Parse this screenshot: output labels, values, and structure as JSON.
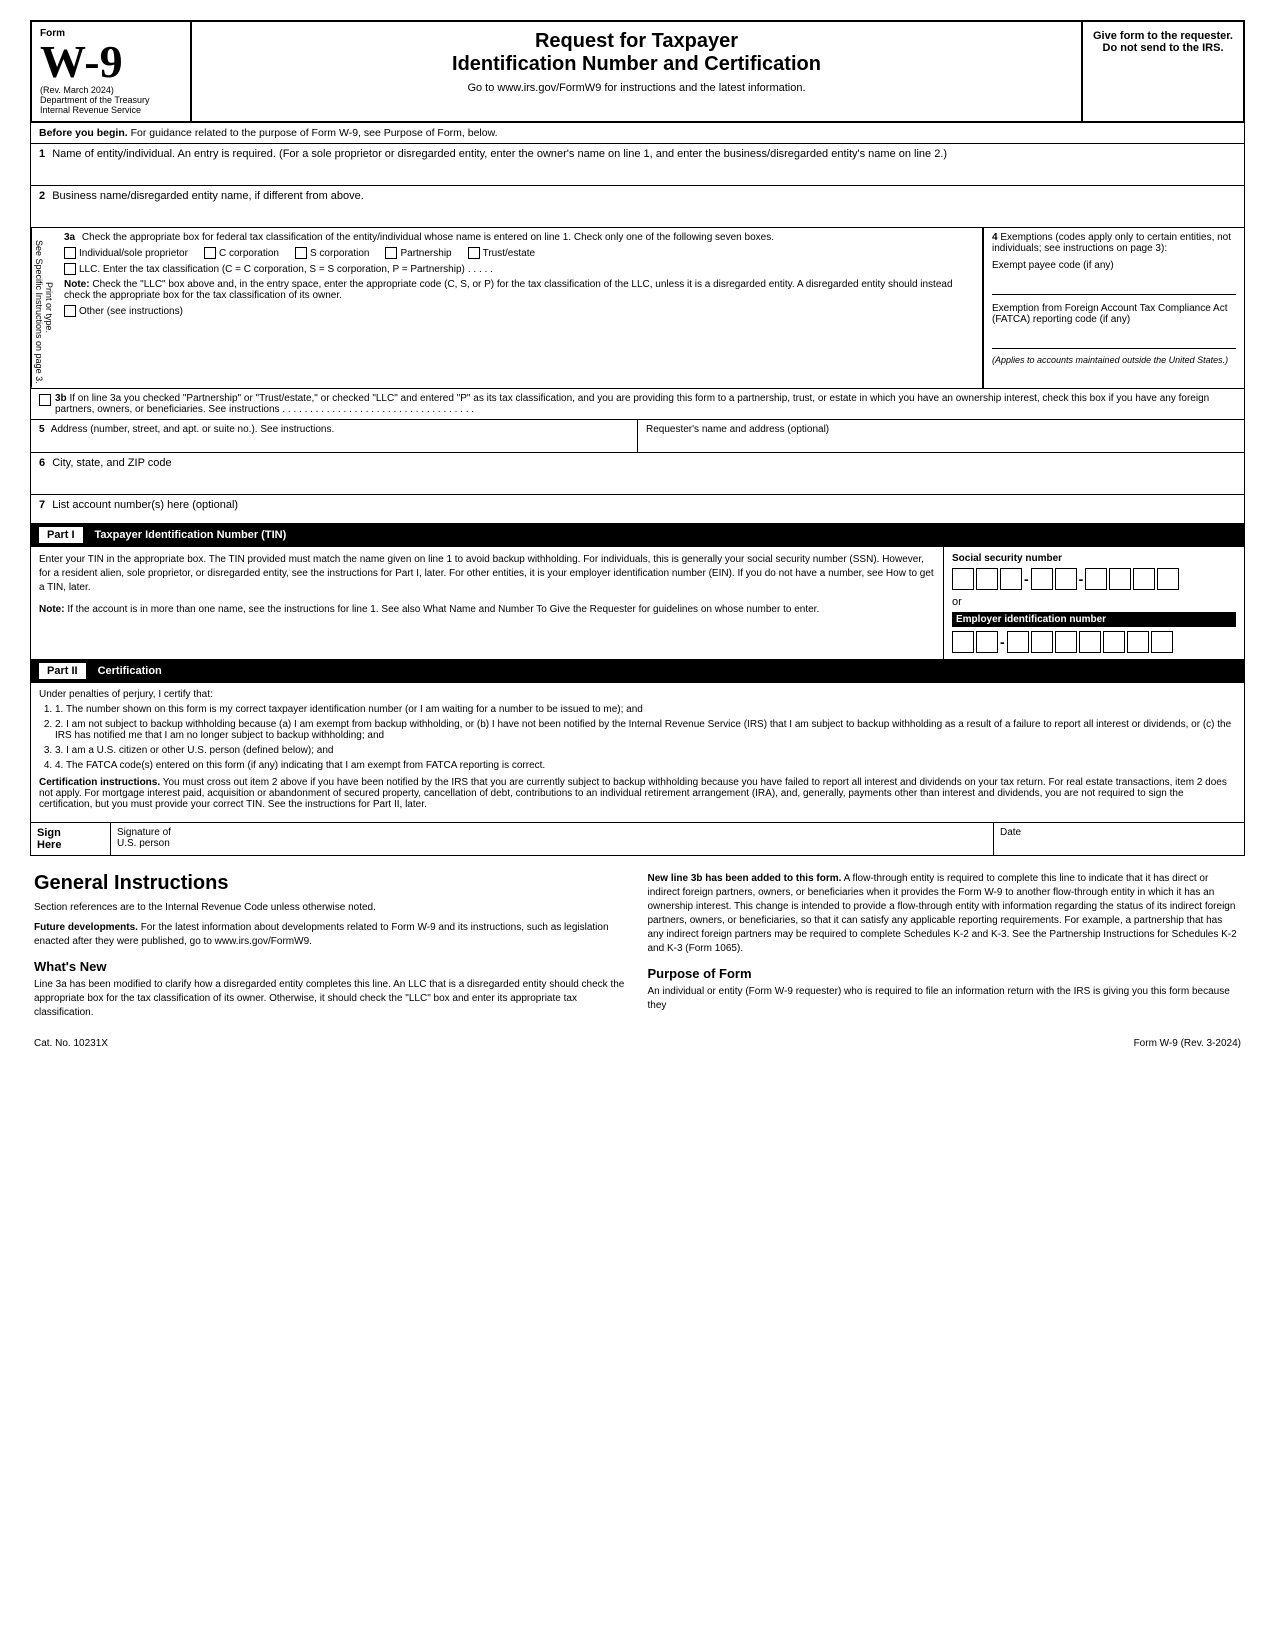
{
  "header": {
    "form_label": "Form",
    "form_number": "W-9",
    "rev_date": "(Rev. March 2024)",
    "dept": "Department of the Treasury",
    "irs": "Internal Revenue Service",
    "title1": "Request for Taxpayer",
    "title2": "Identification Number and Certification",
    "url_instruction": "Go to www.irs.gov/FormW9 for instructions and the latest information.",
    "give_form": "Give form to the requester. Do not send to the IRS."
  },
  "before_begin": {
    "label": "Before you begin.",
    "text": "For guidance related to the purpose of Form W-9, see Purpose of Form, below."
  },
  "fields": {
    "line1_number": "1",
    "line1_label": "Name of entity/individual. An entry is required. (For a sole proprietor or disregarded entity, enter the owner's name on line 1, and enter the business/disregarded entity's name on line 2.)",
    "line2_number": "2",
    "line2_label": "Business name/disregarded entity name, if different from above.",
    "line3a_number": "3a",
    "line3a_label": "Check the appropriate box for federal tax classification of the entity/individual whose name is entered on line 1. Check only one of the following seven boxes.",
    "checkbox_individual": "Individual/sole proprietor",
    "checkbox_c_corp": "C corporation",
    "checkbox_s_corp": "S corporation",
    "checkbox_partnership": "Partnership",
    "checkbox_trust": "Trust/estate",
    "llc_label": "LLC. Enter the tax classification (C = C corporation, S = S corporation, P = Partnership)",
    "llc_dots": ". . . . .",
    "note_label": "Note:",
    "note_text": "Check the \"LLC\" box above and, in the entry space, enter the appropriate code (C, S, or P) for the tax classification of the LLC, unless it is a disregarded entity. A disregarded entity should instead check the appropriate box for the tax classification of its owner.",
    "other_label": "Other (see instructions)",
    "line4_number": "4",
    "line4_heading": "Exemptions (codes apply only to certain entities, not individuals; see instructions on page 3):",
    "exempt_payee_label": "Exempt payee code (if any)",
    "fatca_label": "Exemption from Foreign Account Tax Compliance Act (FATCA) reporting code (if any)",
    "applies_text": "(Applies to accounts maintained outside the United States.)",
    "line3b_number": "3b",
    "line3b_text": "If on line 3a you checked \"Partnership\" or \"Trust/estate,\" or checked \"LLC\" and entered \"P\" as its tax classification, and you are providing this form to a partnership, trust, or estate in which you have an ownership interest, check this box if you have any foreign partners, owners, or beneficiaries. See instructions",
    "line3b_dots": ". . . . . . . . . . . . . . . . . . . . . . . . . . . . . . . . . . .",
    "line5_number": "5",
    "line5_label": "Address (number, street, and apt. or suite no.). See instructions.",
    "requester_label": "Requester's name and address (optional)",
    "line6_number": "6",
    "line6_label": "City, state, and ZIP code",
    "line7_number": "7",
    "line7_label": "List account number(s) here (optional)"
  },
  "side_labels": {
    "label1": "Print or type.",
    "label2": "See Specific Instructions on page 3."
  },
  "part1": {
    "label": "Part I",
    "title": "Taxpayer Identification Number (TIN)",
    "body_text": "Enter your TIN in the appropriate box. The TIN provided must match the name given on line 1 to avoid backup withholding. For individuals, this is generally your social security number (SSN). However, for a resident alien, sole proprietor, or disregarded entity, see the instructions for Part I, later. For other entities, it is your employer identification number (EIN). If you do not have a number, see How to get a TIN, later.",
    "note_label": "Note:",
    "note_text": "If the account is in more than one name, see the instructions for line 1. See also What Name and Number To Give the Requester for guidelines on whose number to enter.",
    "ssn_label": "Social security number",
    "or_label": "or",
    "ein_label": "Employer identification number"
  },
  "part2": {
    "label": "Part II",
    "title": "Certification",
    "intro": "Under penalties of perjury, I certify that:",
    "items": [
      "1. The number shown on this form is my correct taxpayer identification number (or I am waiting for a number to be issued to me); and",
      "2. I am not subject to backup withholding because (a) I am exempt from backup withholding, or (b) I have not been notified by the Internal Revenue Service (IRS) that I am subject to backup withholding as a result of a failure to report all interest or dividends, or (c) the IRS has notified me that I am no longer subject to backup withholding; and",
      "3. I am a U.S. citizen or other U.S. person (defined below); and",
      "4. The FATCA code(s) entered on this form (if any) indicating that I am exempt from FATCA reporting is correct."
    ],
    "cert_instructions_bold": "Certification instructions.",
    "cert_instructions_text": "You must cross out item 2 above if you have been notified by the IRS that you are currently subject to backup withholding because you have failed to report all interest and dividends on your tax return. For real estate transactions, item 2 does not apply. For mortgage interest paid, acquisition or abandonment of secured property, cancellation of debt, contributions to an individual retirement arrangement (IRA), and, generally, payments other than interest and dividends, you are not required to sign the certification, but you must provide your correct TIN. See the instructions for Part II, later."
  },
  "sign_here": {
    "label_line1": "Sign",
    "label_line2": "Here",
    "sig_label": "Signature of",
    "sig_sub": "U.S. person",
    "date_label": "Date"
  },
  "general_instructions": {
    "title": "General Instructions",
    "section_refs": "Section references are to the Internal Revenue Code unless otherwise noted.",
    "future_dev_title": "Future developments.",
    "future_dev_text": "For the latest information about developments related to Form W-9 and its instructions, such as legislation enacted after they were published, go to www.irs.gov/FormW9.",
    "whats_new_title": "What's New",
    "whats_new_text": "Line 3a has been modified to clarify how a disregarded entity completes this line. An LLC that is a disregarded entity should check the appropriate box for the tax classification of its owner. Otherwise, it should check the \"LLC\" box and enter its appropriate tax classification.",
    "right_para1_bold": "New line 3b has been added to this form.",
    "right_para1_text": "A flow-through entity is required to complete this line to indicate that it has direct or indirect foreign partners, owners, or beneficiaries when it provides the Form W-9 to another flow-through entity in which it has an ownership interest. This change is intended to provide a flow-through entity with information regarding the status of its indirect foreign partners, owners, or beneficiaries, so that it can satisfy any applicable reporting requirements. For example, a partnership that has any indirect foreign partners may be required to complete Schedules K-2 and K-3. See the Partnership Instructions for Schedules K-2 and K-3 (Form 1065).",
    "purpose_title": "Purpose of Form",
    "purpose_text": "An individual or entity (Form W-9 requester) who is required to file an information return with the IRS is giving you this form because they"
  },
  "footer": {
    "cat_no": "Cat. No. 10231X",
    "form_label": "Form W-9 (Rev. 3-2024)"
  }
}
